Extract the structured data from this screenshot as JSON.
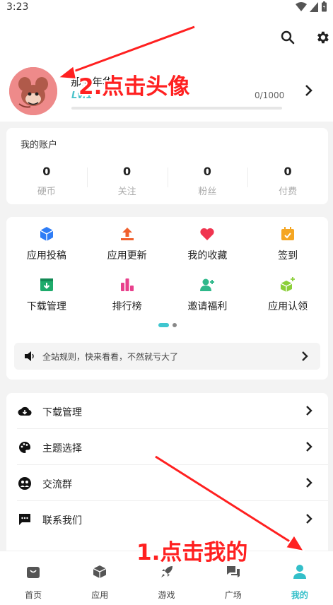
{
  "status_bar": {
    "time": "3:23"
  },
  "profile": {
    "username": "那岁年华",
    "level": "Lv.1",
    "xp": "0/1000",
    "xp_fraction": 0
  },
  "account": {
    "title": "我的账户",
    "stats": [
      {
        "value": "0",
        "label": "硬币"
      },
      {
        "value": "0",
        "label": "关注"
      },
      {
        "value": "0",
        "label": "粉丝"
      },
      {
        "value": "0",
        "label": "付费"
      }
    ]
  },
  "features": [
    {
      "label": "应用投稿",
      "icon": "cube-icon",
      "color": "#2f7df6"
    },
    {
      "label": "应用更新",
      "icon": "upload-icon",
      "color": "#f0602d"
    },
    {
      "label": "我的收藏",
      "icon": "heart-icon",
      "color": "#f0344f"
    },
    {
      "label": "签到",
      "icon": "calendar-icon",
      "color": "#f5a623"
    },
    {
      "label": "下载管理",
      "icon": "download-box-icon",
      "color": "#1eab6b"
    },
    {
      "label": "排行榜",
      "icon": "ranking-icon",
      "color": "#e8408c"
    },
    {
      "label": "邀请福利",
      "icon": "add-user-icon",
      "color": "#2eb88a"
    },
    {
      "label": "应用认领",
      "icon": "cube-plus-icon",
      "color": "#8ccf3a"
    }
  ],
  "notice": {
    "text": "全站规则，快来看看，不然就亏大了"
  },
  "menu": [
    {
      "label": "下载管理",
      "icon": "cloud-download-icon"
    },
    {
      "label": "主题选择",
      "icon": "palette-icon"
    },
    {
      "label": "交流群",
      "icon": "group-icon"
    },
    {
      "label": "联系我们",
      "icon": "chat-icon"
    }
  ],
  "tabs": [
    {
      "label": "首页",
      "icon": "home-bag-icon"
    },
    {
      "label": "应用",
      "icon": "box-icon"
    },
    {
      "label": "游戏",
      "icon": "rocket-icon"
    },
    {
      "label": "广场",
      "icon": "chat-bubbles-icon"
    },
    {
      "label": "我的",
      "icon": "person-icon",
      "active": true
    }
  ],
  "annotations": {
    "step1": "1.点击我的",
    "step2": "2.点击头像"
  },
  "colors": {
    "accent": "#33bfc9",
    "annotation": "#ff2020"
  }
}
